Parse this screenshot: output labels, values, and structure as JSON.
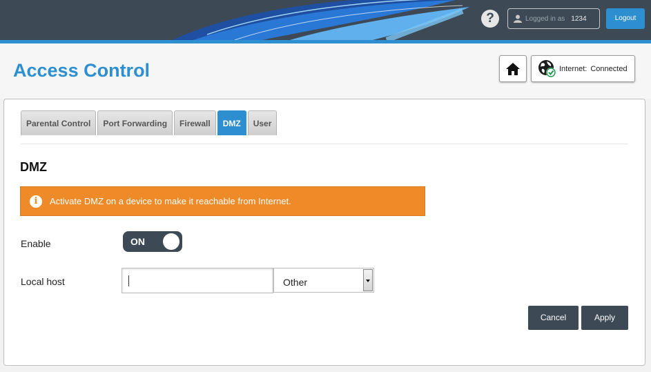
{
  "header": {
    "help_label": "?",
    "logged_in_label": "Logged in as",
    "username": "1234",
    "logout_label": "Logout"
  },
  "title_bar": {
    "page_title": "Access Control",
    "internet_label": "Internet:",
    "internet_status": "Connected",
    "home_icon": "home-icon",
    "globe_icon": "globe-check-icon"
  },
  "tabs": [
    {
      "label": "Parental Control",
      "active": false
    },
    {
      "label": "Port Forwarding",
      "active": false
    },
    {
      "label": "Firewall",
      "active": false
    },
    {
      "label": "DMZ",
      "active": true
    },
    {
      "label": "User",
      "active": false
    }
  ],
  "main": {
    "section_title": "DMZ",
    "alert_text": "Activate DMZ on a device to make it reachable from Internet.",
    "alert_icon": "i",
    "enable_label": "Enable",
    "toggle_label": "ON",
    "local_host_label": "Local host",
    "local_host_value": "",
    "local_host_select": "Other",
    "cancel_label": "Cancel",
    "apply_label": "Apply"
  },
  "colors": {
    "accent": "#2d8fd0",
    "header_bg": "#3d4a55",
    "alert_bg": "#ef8a28"
  }
}
